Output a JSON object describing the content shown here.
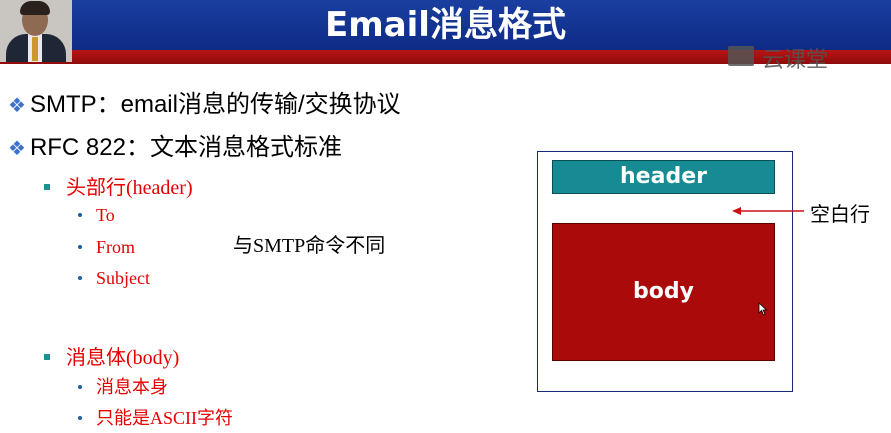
{
  "title": "Email消息格式",
  "logo_text": "云课堂",
  "bullets": [
    {
      "text": "SMTP：email消息的传输/交换协议"
    },
    {
      "text": "RFC 822：文本消息格式标准"
    }
  ],
  "header_section": {
    "label": "头部行(header)",
    "items": [
      "To",
      "From",
      "Subject"
    ]
  },
  "note": "与SMTP命令不同",
  "body_section": {
    "label": "消息体(body)",
    "items": [
      "消息本身",
      "只能是ASCII字符"
    ]
  },
  "diagram": {
    "header_label": "header",
    "body_label": "body",
    "blank_line_label": "空白行"
  },
  "colors": {
    "title_blue": "#1a3fa0",
    "title_red": "#b81414",
    "header_teal": "#168b93",
    "body_red": "#aa0a0a",
    "text_red": "#e60000",
    "bullet_blue": "#3d72c8"
  },
  "icons": [
    "diamond-bullet-icon",
    "square-bullet-icon",
    "dot-bullet-icon",
    "arrow-left-icon",
    "mouse-cursor-icon"
  ]
}
